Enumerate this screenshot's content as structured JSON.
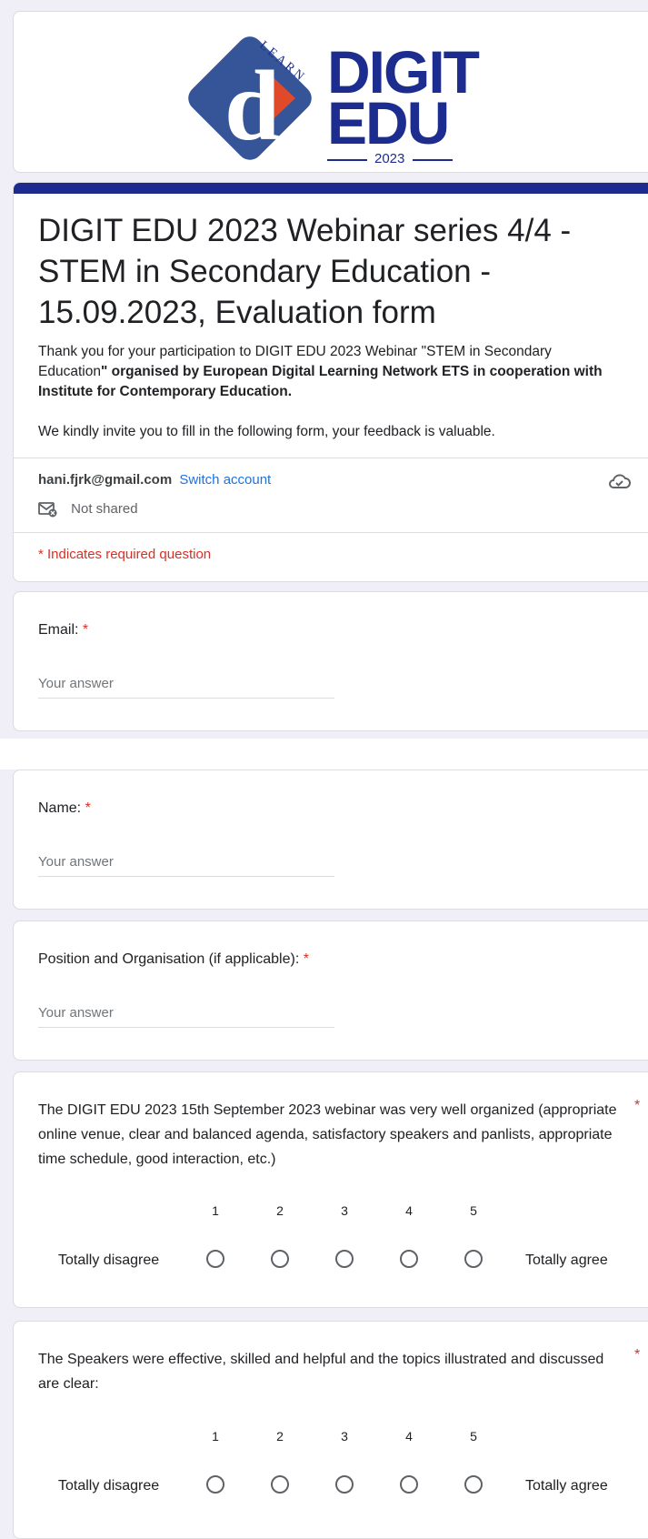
{
  "header": {
    "logo_word1": "DIGIT",
    "logo_word2": "EDU",
    "logo_year": "2023",
    "logo_arc_text": "LEARN",
    "logo_letter": "d"
  },
  "form": {
    "title": "DIGIT EDU 2023 Webinar series 4/4 - STEM in Secondary Education - 15.09.2023, Evaluation form",
    "desc_plain": "Thank you for your participation to DIGIT EDU 2023 Webinar \"STEM in Secondary Education",
    "desc_bold": "\" organised by European Digital Learning Network ETS in cooperation with Institute for Contemporary Education.",
    "desc_2": "We kindly invite you to fill in the following form, your feedback is valuable.",
    "account_email": "hani.fjrk@gmail.com",
    "switch_account": "Switch account",
    "not_shared": "Not shared",
    "required_note": "* Indicates required question"
  },
  "questions": {
    "email_label": "Email:",
    "name_label": "Name:",
    "position_label": "Position and Organisation (if applicable):",
    "answer_placeholder": "Your answer",
    "star": "*",
    "q4_label": "The DIGIT EDU 2023 15th September 2023 webinar was very well organized (appropriate online venue, clear and balanced agenda, satisfactory speakers and panlists, appropriate time schedule, good interaction, etc.)",
    "q5_label": "The Speakers were effective, skilled and helpful and the topics illustrated and discussed are clear:",
    "scale": [
      "1",
      "2",
      "3",
      "4",
      "5"
    ],
    "scale_low": "Totally disagree",
    "scale_high": "Totally agree"
  },
  "colors": {
    "accent": "#1d2a8e",
    "link": "#1a73e8",
    "required": "#d93025",
    "background": "#f0eef6"
  }
}
